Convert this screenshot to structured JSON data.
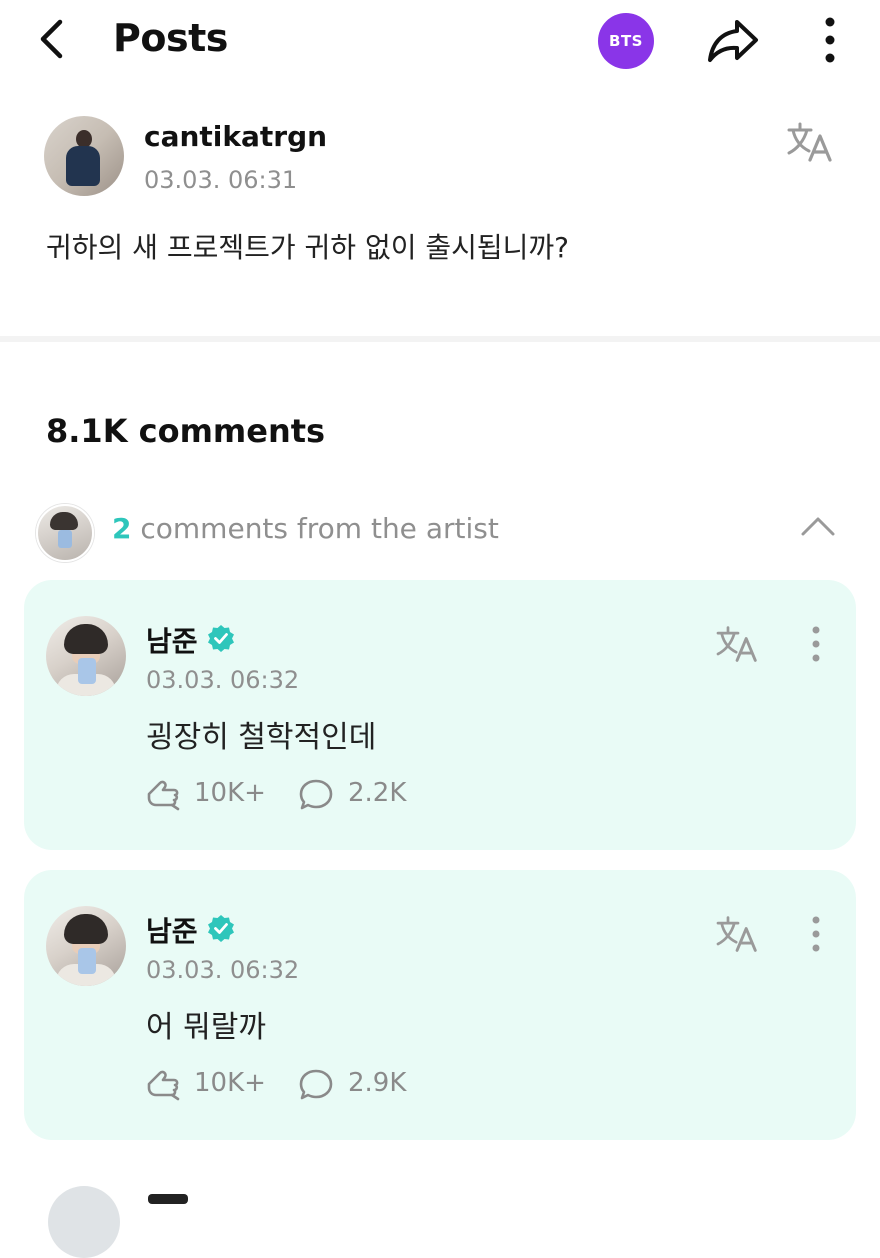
{
  "header": {
    "title": "Posts",
    "community_badge": "BTS",
    "brand_color": "#8a35e8"
  },
  "post": {
    "author": "cantikatrgn",
    "time": "03.03. 06:31",
    "body": "귀하의 새 프로젝트가 귀하 없이 출시됩니까?"
  },
  "comments_header": {
    "count_label": "8.1K comments"
  },
  "artist_comments": {
    "count": "2",
    "label": " comments from the artist",
    "accent_color": "#2ec6bb"
  },
  "comments": [
    {
      "author": "남준",
      "time": "03.03. 06:32",
      "body": "굉장히 철학적인데",
      "likes": "10K+",
      "replies": "2.2K"
    },
    {
      "author": "남준",
      "time": "03.03. 06:32",
      "body": "어 뭐랄까",
      "likes": "10K+",
      "replies": "2.9K"
    }
  ],
  "icons": {
    "back": "chevron-left-icon",
    "share": "share-icon",
    "more": "more-vertical-icon",
    "translate": "translate-icon",
    "collapse": "chevron-up-icon",
    "verified": "verified-icon",
    "like": "like-icon",
    "reply": "reply-icon"
  }
}
